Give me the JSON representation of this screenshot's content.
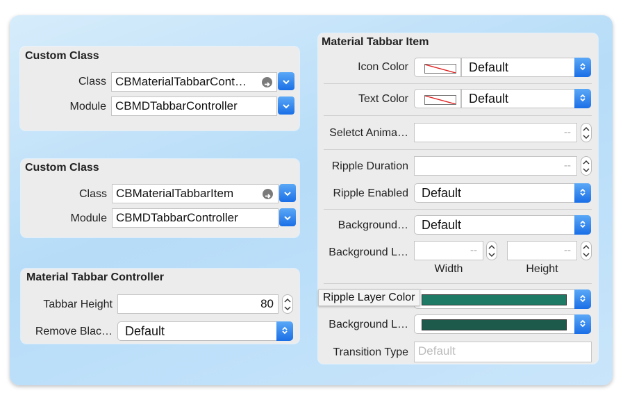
{
  "panel1": {
    "title": "Custom Class",
    "class_label": "Class",
    "class_value": "CBMaterialTabbarCont…",
    "module_label": "Module",
    "module_value": "CBMDTabbarController"
  },
  "panel2": {
    "title": "Custom Class",
    "class_label": "Class",
    "class_value": "CBMaterialTabbarItem",
    "module_label": "Module",
    "module_value": "CBMDTabbarController"
  },
  "panel3": {
    "title": "Material Tabbar Controller",
    "height_label": "Tabbar Height",
    "height_value": "80",
    "remove_label": "Remove Blac…",
    "remove_value": "Default"
  },
  "panel4": {
    "title": "Material Tabbar Item",
    "icon_color_label": "Icon Color",
    "icon_color_value": "Default",
    "text_color_label": "Text Color",
    "text_color_value": "Default",
    "select_anim_label": "Seletct Anima…",
    "select_anim_placeholder": "--",
    "ripple_duration_label": "Ripple Duration",
    "ripple_duration_placeholder": "--",
    "ripple_enabled_label": "Ripple Enabled",
    "ripple_enabled_value": "Default",
    "background1_label": "Background…",
    "background1_value": "Default",
    "background_layer_label": "Background L…",
    "width_placeholder": "--",
    "height_placeholder": "--",
    "width_caption": "Width",
    "height_caption": "Height",
    "ripple_layer_color_tooltip": "Ripple Layer Color",
    "ripple_layer_color_hex": "#1e7a64",
    "background_layer_color_label": "Background L…",
    "background_layer_color_hex": "#1d5a4c",
    "transition_label": "Transition Type",
    "transition_placeholder": "Default"
  },
  "colors": {
    "accent_blue": "#1a6fe6",
    "panel_bg": "#ececec"
  }
}
